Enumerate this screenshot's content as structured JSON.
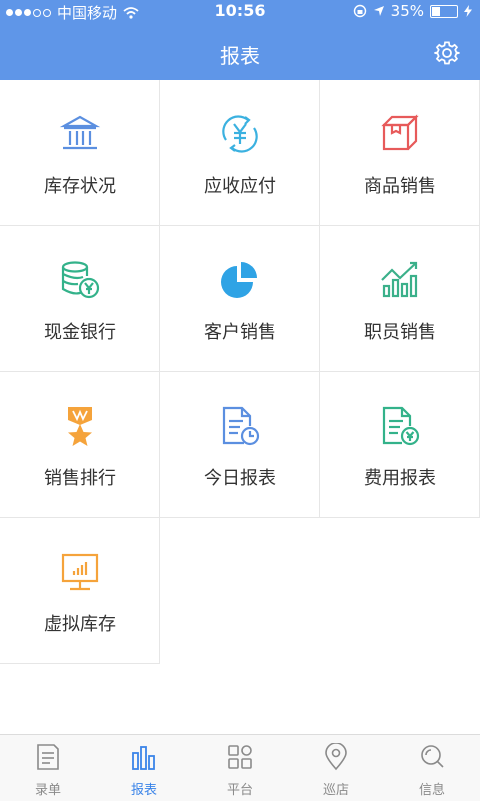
{
  "status_bar": {
    "carrier": "中国移动",
    "time": "10:56",
    "battery": "35%",
    "battery_level": 0.35
  },
  "header": {
    "title": "报表"
  },
  "reports": [
    {
      "label": "库存状况",
      "icon": "bank-icon",
      "color": "#5b8fe0"
    },
    {
      "label": "应收应付",
      "icon": "yen-cycle-icon",
      "color": "#3bb1e0"
    },
    {
      "label": "商品销售",
      "icon": "box-icon",
      "color": "#e75a5a"
    },
    {
      "label": "现金银行",
      "icon": "coin-stack-icon",
      "color": "#33b28a"
    },
    {
      "label": "客户销售",
      "icon": "pie-chart-icon",
      "color": "#2fa3e5"
    },
    {
      "label": "职员销售",
      "icon": "bar-trend-icon",
      "color": "#3bb08a"
    },
    {
      "label": "销售排行",
      "icon": "medal-star-icon",
      "color": "#f5a33b"
    },
    {
      "label": "今日报表",
      "icon": "document-clock-icon",
      "color": "#5b8fe0"
    },
    {
      "label": "费用报表",
      "icon": "document-yen-icon",
      "color": "#33b28a"
    },
    {
      "label": "虚拟库存",
      "icon": "monitor-chart-icon",
      "color": "#f5a33b"
    }
  ],
  "tabbar": {
    "items": [
      {
        "label": "录单",
        "icon": "document-icon"
      },
      {
        "label": "报表",
        "icon": "bar-chart-icon"
      },
      {
        "label": "平台",
        "icon": "grid-icon"
      },
      {
        "label": "巡店",
        "icon": "location-pin-icon"
      },
      {
        "label": "信息",
        "icon": "search-chat-icon"
      }
    ],
    "active_index": 1,
    "active_color": "#3b84e8"
  }
}
